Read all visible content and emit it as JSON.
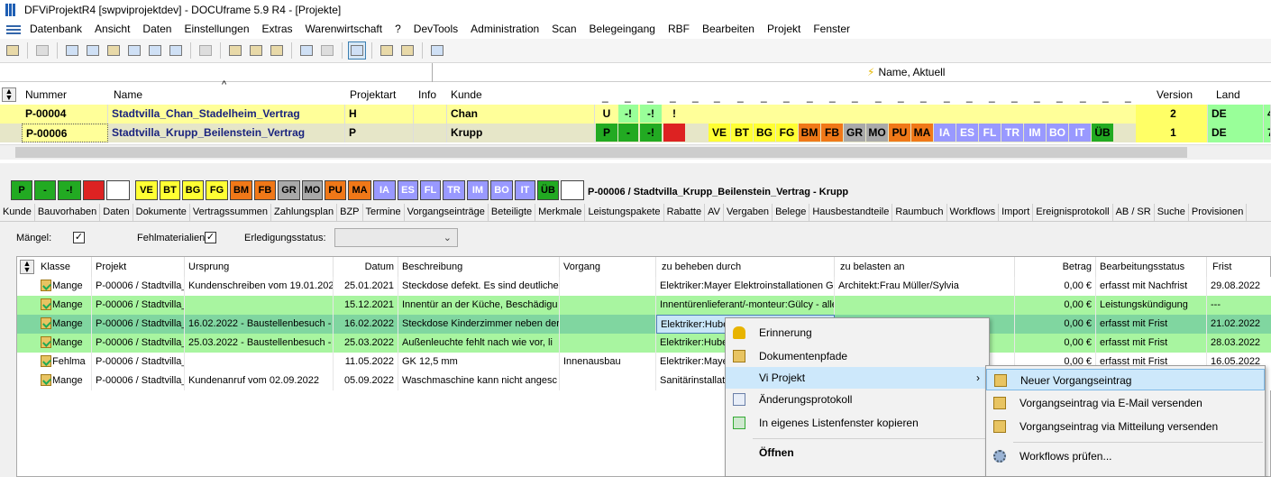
{
  "window": {
    "title": "DFViProjektR4 [swpviprojektdev] - DOCUframe 5.9 R4 - [Projekte]"
  },
  "menu": [
    "Datenbank",
    "Ansicht",
    "Daten",
    "Einstellungen",
    "Extras",
    "Warenwirtschaft",
    "?",
    "DevTools",
    "Administration",
    "Scan",
    "Belegeingang",
    "RBF",
    "Bearbeiten",
    "Projekt",
    "Fenster"
  ],
  "address": {
    "label": "Name, Aktuell"
  },
  "projects_grid": {
    "columns": {
      "nummer": "Nummer",
      "name": "Name",
      "projektart": "Projektart",
      "info": "Info",
      "kunde": "Kunde",
      "version": "Version",
      "land": "Land",
      "flagdash": "_"
    },
    "rows": [
      {
        "nummer": "P-00004",
        "name": "Stadtvilla_Chan_Stadelheim_Vertrag",
        "art": "H",
        "kunde": "Chan",
        "version": "2",
        "land": "DE",
        "last": "4",
        "flags": [
          "U",
          "-!",
          "-!",
          "!"
        ]
      },
      {
        "nummer": "P-00006",
        "name": "Stadtvilla_Krupp_Beilenstein_Vertrag",
        "art": "P",
        "kunde": "Krupp",
        "version": "1",
        "land": "DE",
        "last": "7",
        "flags": [
          "P",
          "-",
          "-!",
          ""
        ],
        "codes": [
          "VE",
          "BT",
          "BG",
          "FG",
          "BM",
          "FB",
          "GR",
          "MO",
          "PU",
          "MA",
          "IA",
          "ES",
          "FL",
          "TR",
          "IM",
          "BO",
          "IT",
          "ÜB"
        ]
      }
    ]
  },
  "status_strip": {
    "boxes": [
      "P",
      "-",
      "-!",
      "",
      "",
      "VE",
      "BT",
      "BG",
      "FG",
      "BM",
      "FB",
      "GR",
      "MO",
      "PU",
      "MA",
      "IA",
      "ES",
      "FL",
      "TR",
      "IM",
      "BO",
      "IT",
      "ÜB",
      ""
    ],
    "title": "P-00006 / Stadtvilla_Krupp_Beilenstein_Vertrag - Krupp"
  },
  "tabs": [
    "Kunde",
    "Bauvorhaben",
    "Daten",
    "Dokumente",
    "Vertragssummen",
    "Zahlungsplan",
    "BZP",
    "Termine",
    "Vorgangseinträge",
    "Beteiligte",
    "Merkmale",
    "Leistungspakete",
    "Rabatte",
    "AV",
    "Vergaben",
    "Belege",
    "Hausbestandteile",
    "Raumbuch",
    "Workflows",
    "Import",
    "Ereignisprotokoll",
    "AB / SR",
    "Suche",
    "Provisionen"
  ],
  "filter": {
    "maengel": "Mängel:",
    "fehlmaterialien": "Fehlmaterialien:",
    "erledigung": "Erledigungsstatus:",
    "check": "✓"
  },
  "detail_grid": {
    "columns": {
      "klasse": "Klasse",
      "projekt": "Projekt",
      "ursprung": "Ursprung",
      "datum": "Datum",
      "beschreibung": "Beschreibung",
      "vorgang": "Vorgang",
      "zubeheben": "zu beheben durch",
      "zubelasten": "zu belasten an",
      "betrag": "Betrag",
      "status": "Bearbeitungsstatus",
      "frist": "Frist"
    },
    "rows": [
      {
        "klasse": "Mange",
        "projekt": "P-00006 / Stadtvilla_",
        "ursprung": "Kundenschreiben vom 19.01.202",
        "datum": "25.01.2021",
        "beschreibung": "Steckdose defekt. Es sind deutliche",
        "vorgang": "",
        "zubeheben": "Elektriker:Mayer Elektroinstallationen Gm",
        "zubelasten": "Architekt:Frau Müller/Sylvia",
        "betrag": "0,00 €",
        "status": "erfasst mit Nachfrist",
        "frist": "29.08.2022"
      },
      {
        "klasse": "Mange",
        "projekt": "P-00006 / Stadtvilla_",
        "ursprung": "",
        "datum": "15.12.2021",
        "beschreibung": "Innentür an der Küche, Beschädigu",
        "vorgang": "",
        "zubeheben": "Innentürenlieferant/-monteur:Gülcy - alle",
        "zubelasten": "",
        "betrag": "0,00 €",
        "status": "Leistungskündigung",
        "frist": "---"
      },
      {
        "klasse": "Mange",
        "projekt": "P-00006 / Stadtvilla_",
        "ursprung": "16.02.2022 - Baustellenbesuch -",
        "datum": "16.02.2022",
        "beschreibung": "Steckdose Kinderzimmer neben der",
        "vorgang": "",
        "zubeheben": "Elektriker:Huber",
        "zubelasten": "",
        "betrag": "0,00 €",
        "status": "erfasst mit Frist",
        "frist": "21.02.2022"
      },
      {
        "klasse": "Mange",
        "projekt": "P-00006 / Stadtvilla_",
        "ursprung": "25.03.2022 - Baustellenbesuch -",
        "datum": "25.03.2022",
        "beschreibung": "Außenleuchte fehlt nach wie vor, li",
        "vorgang": "",
        "zubeheben": "Elektriker:Huber",
        "zubelasten": "",
        "betrag": "0,00 €",
        "status": "erfasst mit Frist",
        "frist": "28.03.2022"
      },
      {
        "klasse": "Fehlma",
        "projekt": "P-00006 / Stadtvilla_",
        "ursprung": "",
        "datum": "11.05.2022",
        "beschreibung": "GK 12,5 mm",
        "vorgang": "Innenausbau",
        "zubeheben": "Elektriker:Mayer",
        "zubelasten": "",
        "betrag": "0,00 €",
        "status": "erfasst mit Frist",
        "frist": "16.05.2022"
      },
      {
        "klasse": "Mange",
        "projekt": "P-00006 / Stadtvilla_",
        "ursprung": "Kundenanruf vom 02.09.2022",
        "datum": "05.09.2022",
        "beschreibung": "Waschmaschine kann nicht angesc",
        "vorgang": "",
        "zubeheben": "Sanitärinstallate",
        "zubelasten": "",
        "betrag": "",
        "status": "",
        "frist": ""
      }
    ]
  },
  "context_menu": {
    "items": [
      "Erinnerung",
      "Dokumentenpfade",
      "Vi Projekt",
      "Änderungsprotokoll",
      "In eigenes Listenfenster kopieren",
      "Öffnen"
    ],
    "submenu": [
      "Neuer Vorgangseintrag",
      "Vorgangseintrag via E-Mail versenden",
      "Vorgangseintrag via Mitteilung versenden",
      "Workflows prüfen..."
    ],
    "arrow": "›"
  },
  "colors": {
    "yellow": "#ffff99",
    "green": "#99ff99",
    "darkgreen": "#22aa22",
    "red": "#dd2222",
    "orange": "#f07818",
    "lilac": "#9999ff",
    "gray": "#a9a9a9",
    "rowgreen": "#a8f5a0",
    "selrow": "#80d6a0"
  }
}
